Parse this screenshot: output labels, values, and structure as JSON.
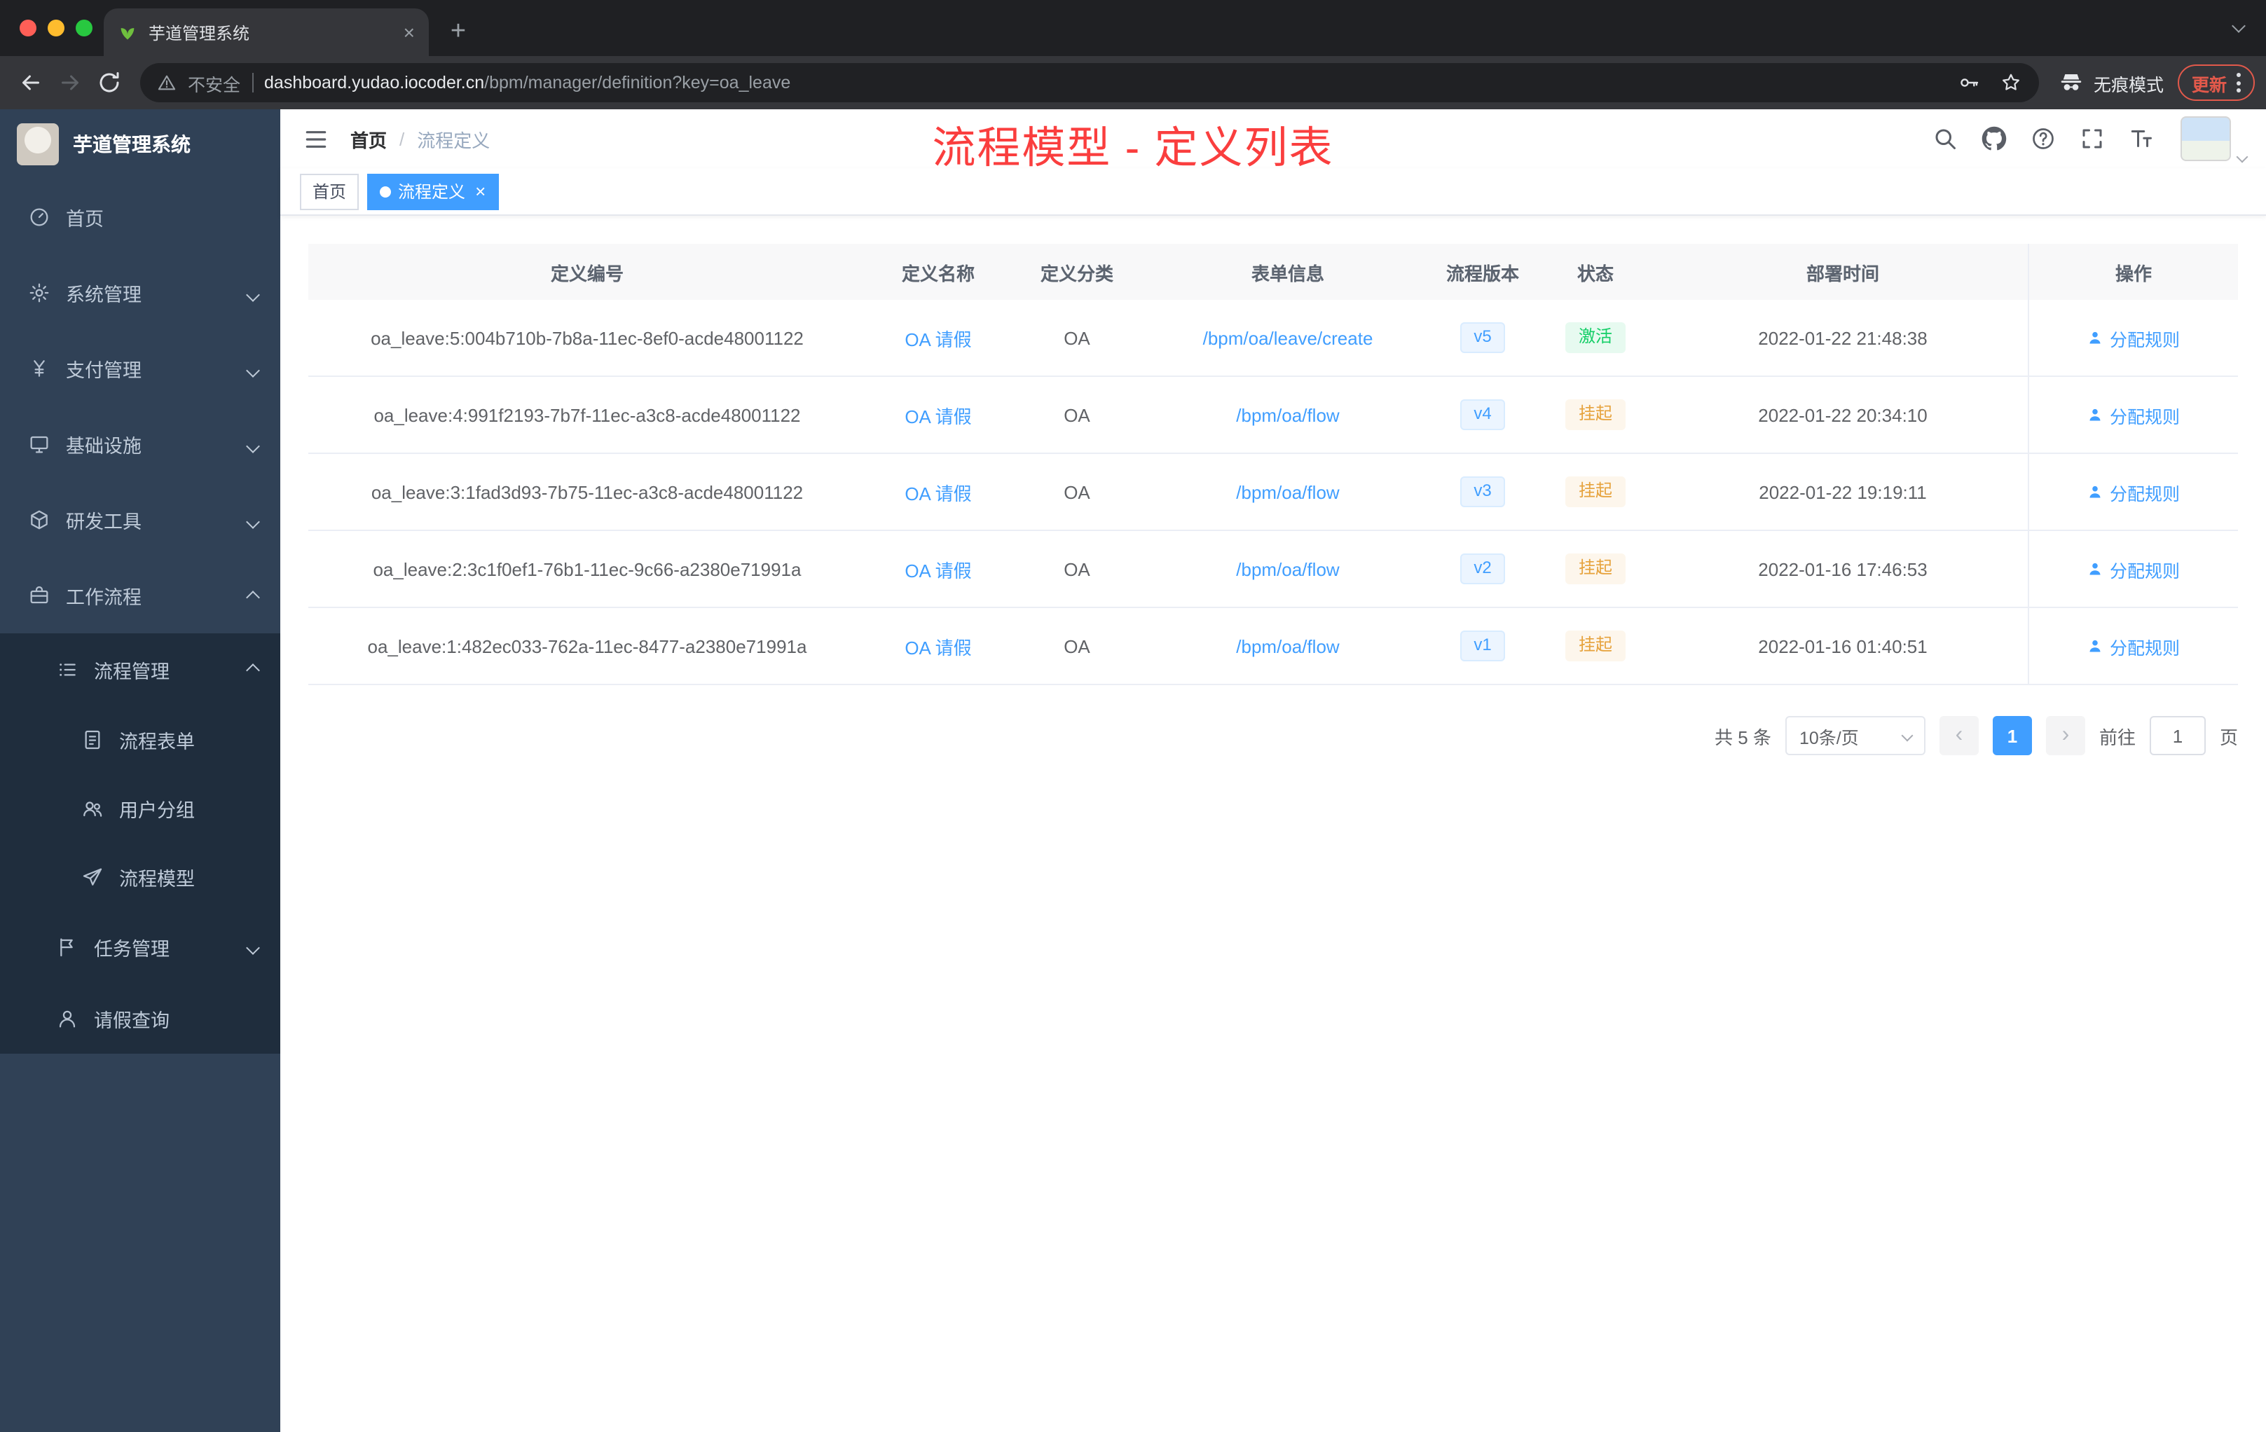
{
  "browser": {
    "tab_title": "芋道管理系统",
    "tab_close": "×",
    "new_tab": "+",
    "security_label": "不安全",
    "url_host": "dashboard.yudao.iocoder.cn",
    "url_path": "/bpm/manager/definition?key=oa_leave",
    "incognito_label": "无痕模式",
    "update_label": "更新"
  },
  "sidebar": {
    "logo_title": "芋道管理系统",
    "items": [
      {
        "label": "首页"
      },
      {
        "label": "系统管理"
      },
      {
        "label": "支付管理"
      },
      {
        "label": "基础设施"
      },
      {
        "label": "研发工具"
      },
      {
        "label": "工作流程"
      },
      {
        "label": "流程管理"
      },
      {
        "label": "流程表单"
      },
      {
        "label": "用户分组"
      },
      {
        "label": "流程模型"
      },
      {
        "label": "任务管理"
      },
      {
        "label": "请假查询"
      }
    ]
  },
  "navbar": {
    "breadcrumb_home": "首页",
    "breadcrumb_sep": "/",
    "breadcrumb_current": "流程定义"
  },
  "annotation": "流程模型 - 定义列表",
  "tags": {
    "home": "首页",
    "current": "流程定义",
    "close": "×"
  },
  "table": {
    "columns": [
      "定义编号",
      "定义名称",
      "定义分类",
      "表单信息",
      "流程版本",
      "状态",
      "部署时间",
      "操作"
    ],
    "rows": [
      {
        "id": "oa_leave:5:004b710b-7b8a-11ec-8ef0-acde48001122",
        "name": "OA 请假",
        "category": "OA",
        "form": "/bpm/oa/leave/create",
        "version": "v5",
        "status": "激活",
        "status_type": "success",
        "deployed": "2022-01-22 21:48:38",
        "action": "分配规则"
      },
      {
        "id": "oa_leave:4:991f2193-7b7f-11ec-a3c8-acde48001122",
        "name": "OA 请假",
        "category": "OA",
        "form": "/bpm/oa/flow",
        "version": "v4",
        "status": "挂起",
        "status_type": "warning",
        "deployed": "2022-01-22 20:34:10",
        "action": "分配规则"
      },
      {
        "id": "oa_leave:3:1fad3d93-7b75-11ec-a3c8-acde48001122",
        "name": "OA 请假",
        "category": "OA",
        "form": "/bpm/oa/flow",
        "version": "v3",
        "status": "挂起",
        "status_type": "warning",
        "deployed": "2022-01-22 19:19:11",
        "action": "分配规则"
      },
      {
        "id": "oa_leave:2:3c1f0ef1-76b1-11ec-9c66-a2380e71991a",
        "name": "OA 请假",
        "category": "OA",
        "form": "/bpm/oa/flow",
        "version": "v2",
        "status": "挂起",
        "status_type": "warning",
        "deployed": "2022-01-16 17:46:53",
        "action": "分配规则"
      },
      {
        "id": "oa_leave:1:482ec033-762a-11ec-8477-a2380e71991a",
        "name": "OA 请假",
        "category": "OA",
        "form": "/bpm/oa/flow",
        "version": "v1",
        "status": "挂起",
        "status_type": "warning",
        "deployed": "2022-01-16 01:40:51",
        "action": "分配规则"
      }
    ]
  },
  "pagination": {
    "total": "共 5 条",
    "page_size": "10条/页",
    "prev": "‹",
    "page": "1",
    "next": "›",
    "goto_label": "前往",
    "goto_value": "1",
    "goto_unit": "页"
  },
  "colors": {
    "accent": "#409eff",
    "success": "#13ce66",
    "warning": "#e6a23c",
    "annotation_red": "#fa3e3e",
    "sidebar_bg": "#304156",
    "submenu_bg": "#1f2d3d",
    "chrome_dark": "#1f2023",
    "chrome_toolbar": "#35363a"
  }
}
